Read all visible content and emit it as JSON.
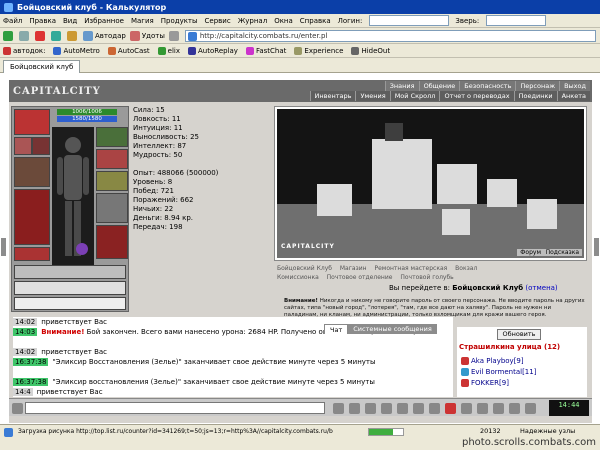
{
  "window": {
    "title": "Бойцовский клуб - Калькулятор"
  },
  "menu": {
    "items": [
      "Файл",
      "Правка",
      "Вид",
      "Избранное",
      "Магия",
      "Продукты",
      "Сервис",
      "Журнал",
      "Окна",
      "Справка"
    ],
    "login_label": "Логин:",
    "zver_label": "Зверь:"
  },
  "toolbar": {
    "avtodar": "Автодар",
    "udoty": "Удоты",
    "address": "http://capitalcity.combats.ru/enter.pl"
  },
  "links": {
    "items": [
      "автодок:",
      "AutoMetro",
      "AutoCast",
      "elix",
      "AutoReplay",
      "FastChat",
      "Experience",
      "HideOut"
    ]
  },
  "tab": {
    "label": "Бойцовский клуб"
  },
  "game": {
    "logo": "CAPITALCITY",
    "nav_top": [
      "Знания",
      "Общение",
      "Безопасность",
      "Персонаж",
      "Выход"
    ],
    "nav_bottom": [
      "Инвентарь",
      "Умения",
      "Мой Скролл",
      "Отчет о переводах",
      "Поединки",
      "Анкета"
    ],
    "hp": "1006/1006",
    "mp": "1580/1580",
    "stats_primary": [
      "Сила: 15",
      "Ловкость: 11",
      "Интуиция: 11",
      "Выносливость: 25",
      "Интеллект: 87",
      "Мудрость: 50"
    ],
    "stats_secondary": [
      "Опыт: 488066 (500000)",
      "Уровень: 8",
      "Побед: 721",
      "Поражений: 662",
      "Ничьих: 22",
      "Деньги: 8.94 кр.",
      "Передач: 198"
    ],
    "scene_caption": "CAPITALCITY",
    "scene_links": [
      "Форум",
      "Подсказка"
    ],
    "location_links": [
      "Бойцовский Клуб",
      "Магазин",
      "Ремонтная мастерская",
      "Вокзал",
      "Комиссионка",
      "Почтовое отделение",
      "Почтовой голубь"
    ],
    "current_location_prefix": "Вы перейдете в:",
    "current_location": "Бойцовский Клуб",
    "current_location_cancel": "(отмена)",
    "warning_title": "Внимание!",
    "warning_text": "Никогда и никому не говорите пароль от своего персонажа. Не вводите пароль на других сайтах, типа \"новый город\", \"лотерея\", \"там, где все дают на халяву\". Пароль не нужен ни паладинам, ни кланам, ни администрации, только взломщикам для кражи вашего героя."
  },
  "chat": {
    "tabs": [
      "Чат",
      "Системные сообщения"
    ],
    "lines": [
      {
        "time": "14:02",
        "text": "приветствует Вас"
      },
      {
        "time": "14:03",
        "red": "Внимание!",
        "text": "Бой закончен. Всего вами нанесено урона: 2684 HP. Получено опыта: 18000 (211.7535%)."
      },
      {
        "time": "14:02",
        "text": "приветствует Вас"
      },
      {
        "time": "16:37:38",
        "text": "\"Эликсир Восстановления (Зелье)\" заканчивает свое действие минуте через 5 минуты"
      },
      {
        "time": "16:37:38",
        "text": "\"Эликсир восстановления (Зелье)\" заканчивает свое действие минуте через 5 минуты"
      },
      {
        "time": "14:4",
        "text": "приветствует Вас"
      }
    ]
  },
  "users": {
    "refresh_label": "Обновить",
    "room_title": "Страшилкина улица (12)",
    "list": [
      {
        "name": "Aka Playboy",
        "level": "[9]"
      },
      {
        "name": "Evil Bormental",
        "level": "[11]"
      },
      {
        "name": "FOKKER",
        "level": "[9]"
      }
    ]
  },
  "clock": {
    "time": "14:44"
  },
  "status": {
    "text": "Загрузка рисунка http://top.list.ru/counter?id=341269;t=50;js=13;r=http%3A//capitalcity.combats.ru/b",
    "progress": 0.7,
    "count": "20132",
    "zone": "Надежные узлы",
    "watermark": "photo.scrolls.combats.com"
  }
}
